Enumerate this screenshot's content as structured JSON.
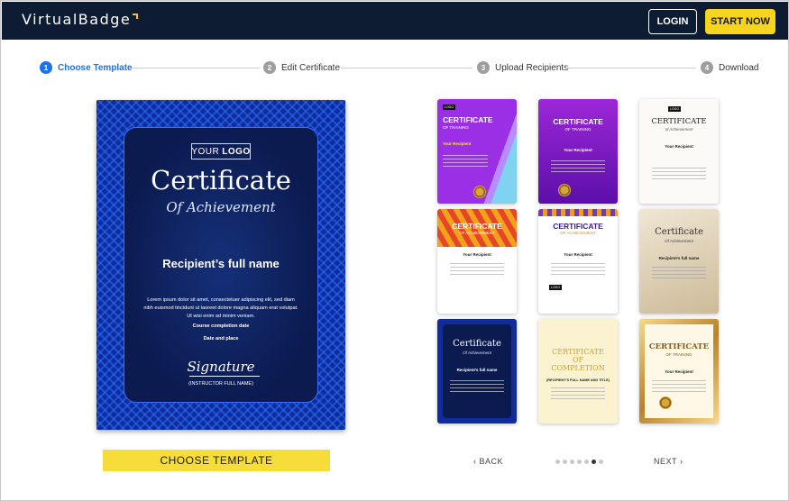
{
  "header": {
    "logo_text": "VirtualBadge",
    "login_label": "LOGIN",
    "start_label": "START NOW"
  },
  "steps": [
    {
      "num": "1",
      "label": "Choose Template",
      "active": true
    },
    {
      "num": "2",
      "label": "Edit Certificate",
      "active": false
    },
    {
      "num": "3",
      "label": "Upload Recipients",
      "active": false
    },
    {
      "num": "4",
      "label": "Download",
      "active": false
    }
  ],
  "preview": {
    "logo_your": "YOUR",
    "logo_logo": "LOGO",
    "title": "Certificate",
    "subtitle": "Of Achievement",
    "recipient": "Recipient’s full name",
    "lorem": "Lorem ipsum dolor sit amet, consectetuer adipiscing elit, sed diam nibh euismod tincidunt ut laoreet dolore magna aliquam erat volutpat. Ut wisi enim ad minim veniam.",
    "completion_date": "Course completion date",
    "date_place": "Date and place",
    "signature": "Signature",
    "instructor": "(INSTRUCTOR FULL NAME)"
  },
  "choose_button": "CHOOSE TEMPLATE",
  "thumbnails": [
    {
      "title": "CERTIFICATE",
      "sub": "OF TRAINING",
      "recipient": "Your Recipient"
    },
    {
      "title": "CERTIFICATE",
      "sub": "OF TRAINING",
      "recipient": "Your Recipient"
    },
    {
      "title": "CERTIFICATE",
      "sub": "of Achievement",
      "recipient": "Your Recipient"
    },
    {
      "title": "CERTIFICATE",
      "sub": "OF ACHIEVEMENT",
      "recipient": "Your Recipient"
    },
    {
      "title": "CERTIFICATE",
      "sub": "OF ACHIEVEMENT",
      "recipient": "Your Recipient"
    },
    {
      "title": "Certificate",
      "sub": "Of Achievement",
      "recipient": "Recipient’s full name"
    },
    {
      "title": "Certificate",
      "sub": "Of Achievement",
      "recipient": "Recipient’s full name"
    },
    {
      "title": "CERTIFICATE OF COMPLETION",
      "sub": "",
      "recipient": "(RECIPIENT'S FULL NAME AND TITLE)"
    },
    {
      "title": "CERTIFICATE",
      "sub": "OF TRAINING",
      "recipient": "Your Recipient"
    }
  ],
  "pager": {
    "back_label": "BACK",
    "next_label": "NEXT",
    "page_count": 7,
    "active_page": 6
  },
  "colors": {
    "header_bg": "#0d1b33",
    "accent_yellow": "#f7d51e",
    "step_active": "#1a73e8"
  }
}
